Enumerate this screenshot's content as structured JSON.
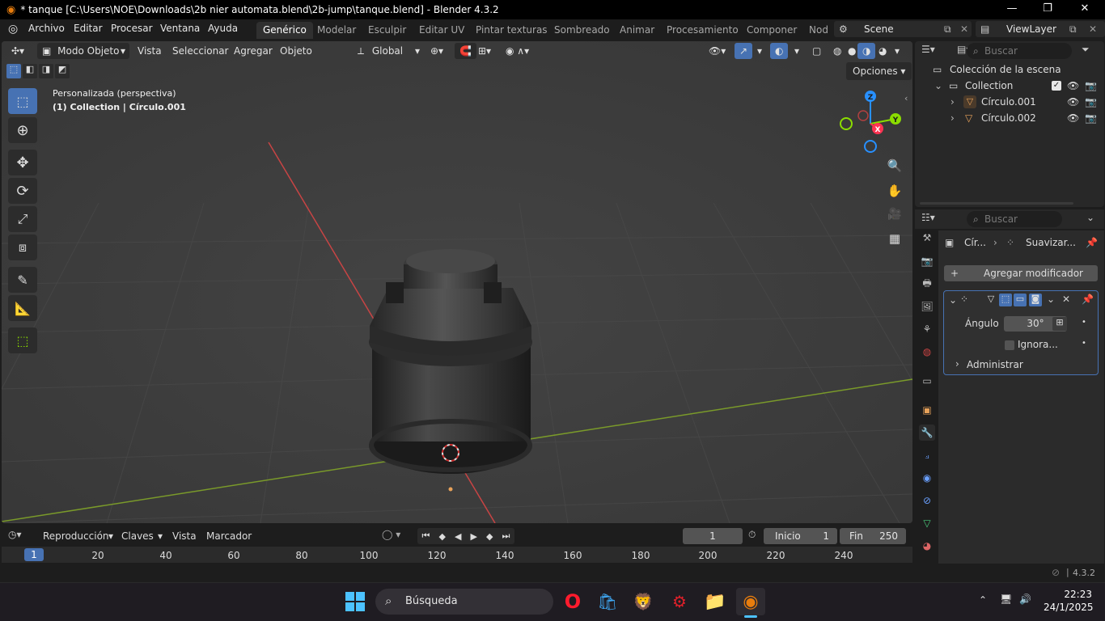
{
  "window": {
    "title": "* tanque [C:\\Users\\NOE\\Downloads\\2b nier automata.blend\\2b-jump\\tanque.blend] - Blender 4.3.2",
    "minimize": "—",
    "maximize": "❐",
    "close": "✕"
  },
  "menu": {
    "items": [
      "Archivo",
      "Editar",
      "Procesar",
      "Ventana",
      "Ayuda"
    ],
    "workspaces": [
      "Genérico",
      "Modelar",
      "Esculpir",
      "Editar UV",
      "Pintar texturas",
      "Sombreado",
      "Animar",
      "Procesamiento",
      "Componer",
      "Nod"
    ],
    "scene": "Scene",
    "view_layer": "ViewLayer"
  },
  "viewport": {
    "mode": "Modo Objeto",
    "menus": [
      "Vista",
      "Seleccionar",
      "Agregar",
      "Objeto"
    ],
    "orientation": "Global",
    "options": "Opciones",
    "info_line1": "Personalizada (perspectiva)",
    "info_line2": "(1) Collection | Círculo.001",
    "gizmo": {
      "x": "X",
      "y": "Y",
      "z": "Z"
    }
  },
  "outliner": {
    "search_placeholder": "Buscar",
    "scene_collection": "Colección de la escena",
    "collection": "Collection",
    "objects": [
      "Círculo.001",
      "Círculo.002"
    ]
  },
  "properties": {
    "search_placeholder": "Buscar",
    "breadcrumb_object": "Cír...",
    "breadcrumb_modifier": "Suavizar...",
    "add_modifier": "Agregar modificador",
    "angle_label": "Ángulo",
    "angle_value": "30°",
    "ignore_label": "Ignora...",
    "manage_label": "Administrar"
  },
  "timeline": {
    "playback": "Reproducción",
    "keys": "Claves",
    "view": "Vista",
    "marker": "Marcador",
    "current_frame": "1",
    "start_label": "Inicio",
    "start_value": "1",
    "end_label": "Fin",
    "end_value": "250",
    "ruler": [
      "1",
      "20",
      "40",
      "60",
      "80",
      "100",
      "120",
      "140",
      "160",
      "180",
      "200",
      "220",
      "240"
    ]
  },
  "status": {
    "version": "4.3.2"
  },
  "taskbar": {
    "search": "Búsqueda",
    "time": "22:23",
    "date": "24/1/2025"
  },
  "colors": {
    "accent": "#4772b3",
    "axis_x": "#ff3352",
    "axis_y": "#8bdc00",
    "axis_z": "#2890ff",
    "object_orange": "#e8a25a"
  }
}
